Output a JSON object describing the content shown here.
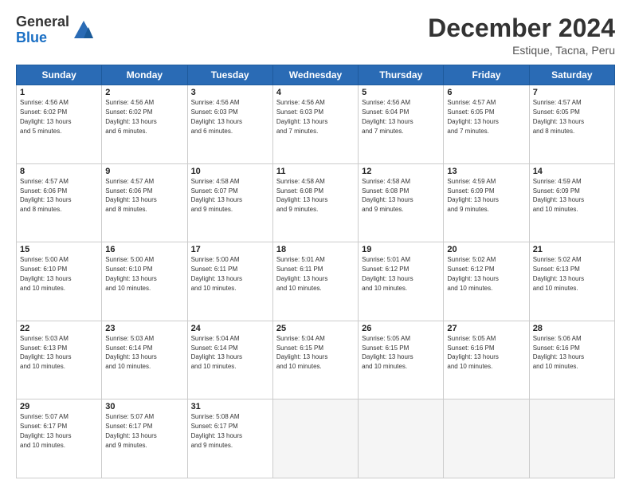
{
  "logo": {
    "general": "General",
    "blue": "Blue"
  },
  "header": {
    "month": "December 2024",
    "location": "Estique, Tacna, Peru"
  },
  "weekdays": [
    "Sunday",
    "Monday",
    "Tuesday",
    "Wednesday",
    "Thursday",
    "Friday",
    "Saturday"
  ],
  "days": [
    {
      "date": "1",
      "sunrise": "4:56 AM",
      "sunset": "6:02 PM",
      "daylight": "13 hours and 5 minutes."
    },
    {
      "date": "2",
      "sunrise": "4:56 AM",
      "sunset": "6:02 PM",
      "daylight": "13 hours and 6 minutes."
    },
    {
      "date": "3",
      "sunrise": "4:56 AM",
      "sunset": "6:03 PM",
      "daylight": "13 hours and 6 minutes."
    },
    {
      "date": "4",
      "sunrise": "4:56 AM",
      "sunset": "6:03 PM",
      "daylight": "13 hours and 7 minutes."
    },
    {
      "date": "5",
      "sunrise": "4:56 AM",
      "sunset": "6:04 PM",
      "daylight": "13 hours and 7 minutes."
    },
    {
      "date": "6",
      "sunrise": "4:57 AM",
      "sunset": "6:05 PM",
      "daylight": "13 hours and 7 minutes."
    },
    {
      "date": "7",
      "sunrise": "4:57 AM",
      "sunset": "6:05 PM",
      "daylight": "13 hours and 8 minutes."
    },
    {
      "date": "8",
      "sunrise": "4:57 AM",
      "sunset": "6:06 PM",
      "daylight": "13 hours and 8 minutes."
    },
    {
      "date": "9",
      "sunrise": "4:57 AM",
      "sunset": "6:06 PM",
      "daylight": "13 hours and 8 minutes."
    },
    {
      "date": "10",
      "sunrise": "4:58 AM",
      "sunset": "6:07 PM",
      "daylight": "13 hours and 9 minutes."
    },
    {
      "date": "11",
      "sunrise": "4:58 AM",
      "sunset": "6:08 PM",
      "daylight": "13 hours and 9 minutes."
    },
    {
      "date": "12",
      "sunrise": "4:58 AM",
      "sunset": "6:08 PM",
      "daylight": "13 hours and 9 minutes."
    },
    {
      "date": "13",
      "sunrise": "4:59 AM",
      "sunset": "6:09 PM",
      "daylight": "13 hours and 9 minutes."
    },
    {
      "date": "14",
      "sunrise": "4:59 AM",
      "sunset": "6:09 PM",
      "daylight": "13 hours and 10 minutes."
    },
    {
      "date": "15",
      "sunrise": "5:00 AM",
      "sunset": "6:10 PM",
      "daylight": "13 hours and 10 minutes."
    },
    {
      "date": "16",
      "sunrise": "5:00 AM",
      "sunset": "6:10 PM",
      "daylight": "13 hours and 10 minutes."
    },
    {
      "date": "17",
      "sunrise": "5:00 AM",
      "sunset": "6:11 PM",
      "daylight": "13 hours and 10 minutes."
    },
    {
      "date": "18",
      "sunrise": "5:01 AM",
      "sunset": "6:11 PM",
      "daylight": "13 hours and 10 minutes."
    },
    {
      "date": "19",
      "sunrise": "5:01 AM",
      "sunset": "6:12 PM",
      "daylight": "13 hours and 10 minutes."
    },
    {
      "date": "20",
      "sunrise": "5:02 AM",
      "sunset": "6:12 PM",
      "daylight": "13 hours and 10 minutes."
    },
    {
      "date": "21",
      "sunrise": "5:02 AM",
      "sunset": "6:13 PM",
      "daylight": "13 hours and 10 minutes."
    },
    {
      "date": "22",
      "sunrise": "5:03 AM",
      "sunset": "6:13 PM",
      "daylight": "13 hours and 10 minutes."
    },
    {
      "date": "23",
      "sunrise": "5:03 AM",
      "sunset": "6:14 PM",
      "daylight": "13 hours and 10 minutes."
    },
    {
      "date": "24",
      "sunrise": "5:04 AM",
      "sunset": "6:14 PM",
      "daylight": "13 hours and 10 minutes."
    },
    {
      "date": "25",
      "sunrise": "5:04 AM",
      "sunset": "6:15 PM",
      "daylight": "13 hours and 10 minutes."
    },
    {
      "date": "26",
      "sunrise": "5:05 AM",
      "sunset": "6:15 PM",
      "daylight": "13 hours and 10 minutes."
    },
    {
      "date": "27",
      "sunrise": "5:05 AM",
      "sunset": "6:16 PM",
      "daylight": "13 hours and 10 minutes."
    },
    {
      "date": "28",
      "sunrise": "5:06 AM",
      "sunset": "6:16 PM",
      "daylight": "13 hours and 10 minutes."
    },
    {
      "date": "29",
      "sunrise": "5:07 AM",
      "sunset": "6:17 PM",
      "daylight": "13 hours and 10 minutes."
    },
    {
      "date": "30",
      "sunrise": "5:07 AM",
      "sunset": "6:17 PM",
      "daylight": "13 hours and 9 minutes."
    },
    {
      "date": "31",
      "sunrise": "5:08 AM",
      "sunset": "6:17 PM",
      "daylight": "13 hours and 9 minutes."
    }
  ],
  "labels": {
    "sunrise": "Sunrise:",
    "sunset": "Sunset:",
    "daylight": "Daylight:"
  }
}
